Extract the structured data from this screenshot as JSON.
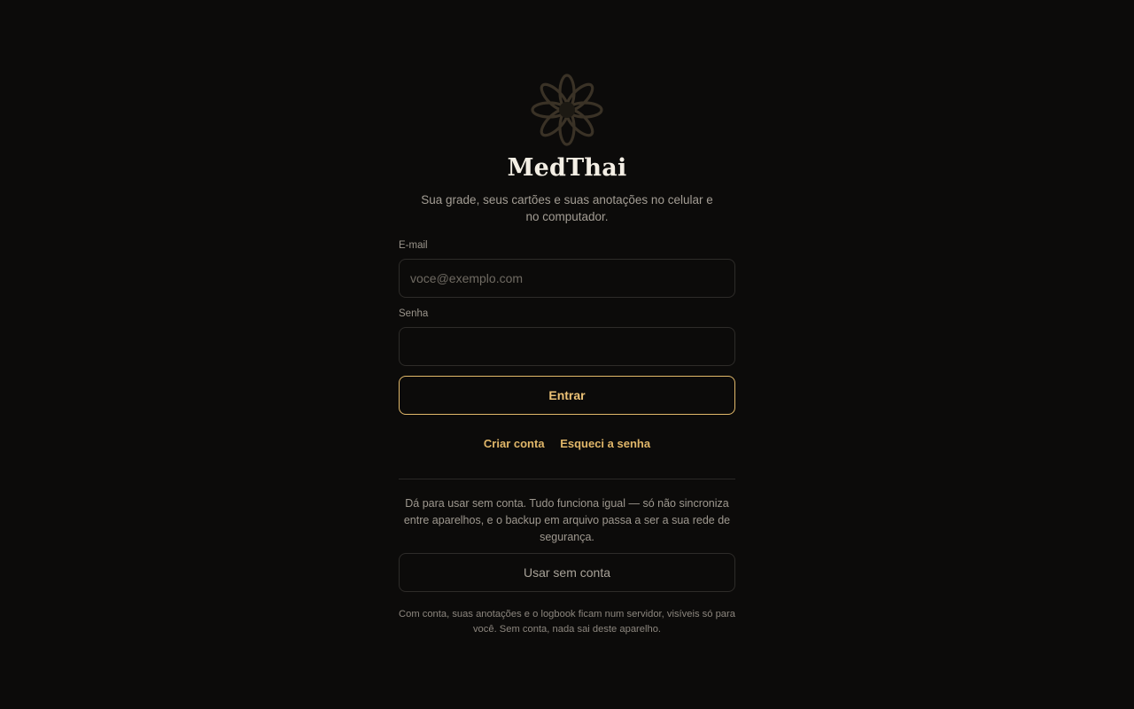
{
  "brand": {
    "name": "MedThai",
    "tagline": "Sua grade, seus cartões e suas anotações no celular e no computador.",
    "logo_icon": "lotus-flower-icon",
    "logo_color": "#3a3226"
  },
  "login_form": {
    "email_label": "E-mail",
    "email_placeholder": "voce@exemplo.com",
    "email_value": "",
    "password_label": "Senha",
    "password_value": "",
    "submit_label": "Entrar"
  },
  "links": {
    "create_account": "Criar conta",
    "forgot_password": "Esqueci a senha"
  },
  "offline": {
    "note": "Dá para usar sem conta. Tudo funciona igual — só não sincroniza entre aparelhos, e o backup em arquivo passa a ser a sua rede de segurança.",
    "button_label": "Usar sem conta"
  },
  "footnote": "Com conta, suas anotações e o logbook ficam num servidor, visíveis só para você. Sem conta, nada sai deste aparelho.",
  "colors": {
    "background": "#0c0b0a",
    "accent": "#e2b96a",
    "text_primary": "#f3eee4",
    "text_muted": "#a39d94"
  }
}
